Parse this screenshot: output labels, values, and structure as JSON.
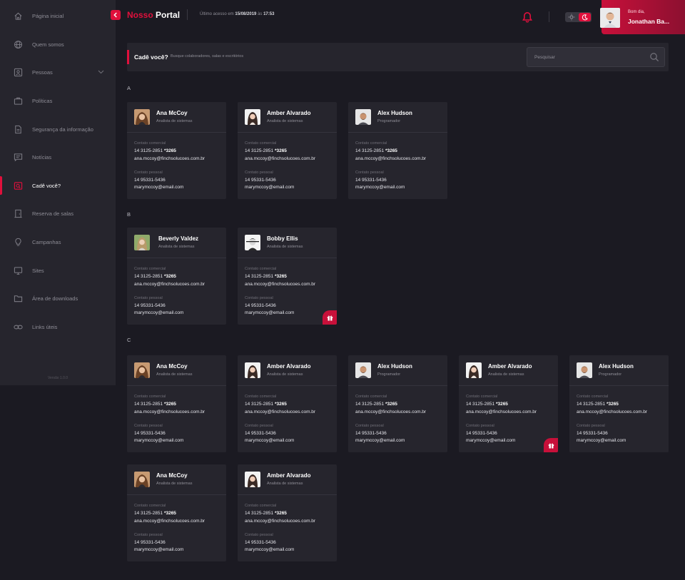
{
  "sidebar": {
    "items": [
      {
        "label": "Página inicial"
      },
      {
        "label": "Quem somos"
      },
      {
        "label": "Pessoas"
      },
      {
        "label": "Políticas"
      },
      {
        "label": "Segurança da informação"
      },
      {
        "label": "Notícias"
      },
      {
        "label": "Cadê você?"
      },
      {
        "label": "Reserva de salas"
      },
      {
        "label": "Campanhas"
      },
      {
        "label": "Sites"
      },
      {
        "label": "Área de downloads"
      },
      {
        "label": "Links úteis"
      }
    ],
    "version": "Versão 1.0.0"
  },
  "header": {
    "brand_first": "Nosso",
    "brand_second": "Portal",
    "last_access_prefix": "Último acesso em",
    "last_access_date": "15/08/2019",
    "last_access_mid": "às",
    "last_access_time": "17:53",
    "greeting": "Bom dia,",
    "user_name": "Jonathan Ba..."
  },
  "search": {
    "title": "Cadê você?",
    "subtitle": "Busque colaboradores, salas e escritórios",
    "placeholder": "Pesquisar"
  },
  "sections": [
    "A",
    "B",
    "C"
  ],
  "labels": {
    "work": "Contato comercial",
    "personal": "Contato pessoal"
  },
  "cards": [
    {
      "name": "Ana McCoy",
      "role": "Analista de sistemas",
      "phone": "14 3125-2851",
      "ext": "*3265",
      "work_email": "ana.mccoy@finchsolucoes.com.br",
      "personal_phone": "14 95331-5436",
      "personal_email": "marymccoy@email.com",
      "birthday": false
    },
    {
      "name": "Amber Alvarado",
      "role": "Analista de sistemas",
      "phone": "14 3125-2851",
      "ext": "*3265",
      "work_email": "ana.mccoy@finchsolucoes.com.br",
      "personal_phone": "14 95331-5436",
      "personal_email": "marymccoy@email.com",
      "birthday": false
    },
    {
      "name": "Alex Hudson",
      "role": "Programador",
      "phone": "14 3125-2851",
      "ext": "*3265",
      "work_email": "ana.mccoy@finchsolucoes.com.br",
      "personal_phone": "14 95331-5436",
      "personal_email": "marymccoy@email.com",
      "birthday": false
    },
    {
      "name": "Beverly Valdez",
      "role": "Analista de sistemas",
      "phone": "14 3125-2851",
      "ext": "*3265",
      "work_email": "ana.mccoy@finchsolucoes.com.br",
      "personal_phone": "14 95331-5436",
      "personal_email": "marymccoy@email.com",
      "birthday": false
    },
    {
      "name": "Bobby Ellis",
      "role": "Analista de sistemas",
      "phone": "14 3125-2851",
      "ext": "*3265",
      "work_email": "ana.mccoy@finchsolucoes.com.br",
      "personal_phone": "14 95331-5436",
      "personal_email": "marymccoy@email.com",
      "birthday": true
    },
    {
      "name": "Ana McCoy",
      "role": "Analista de sistemas",
      "phone": "14 3125-2851",
      "ext": "*3265",
      "work_email": "ana.mccoy@finchsolucoes.com.br",
      "personal_phone": "14 95331-5436",
      "personal_email": "marymccoy@email.com",
      "birthday": false
    },
    {
      "name": "Amber Alvarado",
      "role": "Analista de sistemas",
      "phone": "14 3125-2851",
      "ext": "*3265",
      "work_email": "ana.mccoy@finchsolucoes.com.br",
      "personal_phone": "14 95331-5436",
      "personal_email": "marymccoy@email.com",
      "birthday": false
    },
    {
      "name": "Alex Hudson",
      "role": "Programador",
      "phone": "14 3125-2851",
      "ext": "*3265",
      "work_email": "ana.mccoy@finchsolucoes.com.br",
      "personal_phone": "14 95331-5436",
      "personal_email": "marymccoy@email.com",
      "birthday": false
    },
    {
      "name": "Amber Alvarado",
      "role": "Analista de sistemas",
      "phone": "14 3125-2851",
      "ext": "*3265",
      "work_email": "ana.mccoy@finchsolucoes.com.br",
      "personal_phone": "14 95331-5436",
      "personal_email": "marymccoy@email.com",
      "birthday": true
    },
    {
      "name": "Alex Hudson",
      "role": "Programador",
      "phone": "14 3125-2851",
      "ext": "*3265",
      "work_email": "ana.mccoy@finchsolucoes.com.br",
      "personal_phone": "14 95331-5436",
      "personal_email": "marymccoy@email.com",
      "birthday": false
    },
    {
      "name": "Ana McCoy",
      "role": "Analista de sistemas",
      "phone": "14 3125-2851",
      "ext": "*3265",
      "work_email": "ana.mccoy@finchsolucoes.com.br",
      "personal_phone": "14 95331-5436",
      "personal_email": "marymccoy@email.com",
      "birthday": false
    },
    {
      "name": "Amber Alvarado",
      "role": "Analista de sistemas",
      "phone": "14 3125-2851",
      "ext": "*3265",
      "work_email": "ana.mccoy@finchsolucoes.com.br",
      "personal_phone": "14 95331-5436",
      "personal_email": "marymccoy@email.com",
      "birthday": false
    }
  ],
  "colors": {
    "accent": "#e0103c",
    "background": "#1b1a22",
    "surface": "#26252d"
  }
}
